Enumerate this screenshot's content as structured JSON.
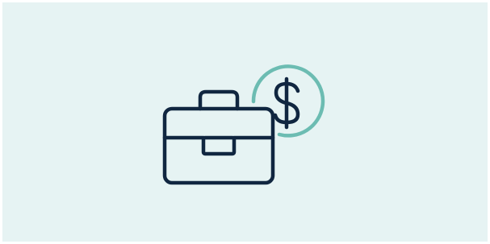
{
  "illustration": {
    "subject": "briefcase-with-dollar-coin",
    "icons": [
      "briefcase-icon",
      "dollar-coin-icon"
    ],
    "colors": {
      "background": "#e6f3f3",
      "stroke_dark": "#102640",
      "stroke_accent": "#6cbcb2"
    }
  }
}
